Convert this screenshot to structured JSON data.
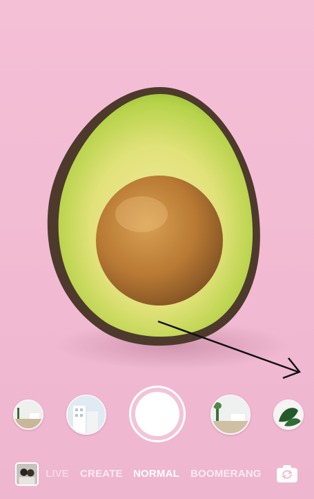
{
  "camera": {
    "background": "avocado-on-pink",
    "accent": "#ffffff",
    "backdrop_color": "#f2bcd4"
  },
  "filters": [
    {
      "name": "room-plant-filter"
    },
    {
      "name": "building-filter"
    },
    {
      "name": "interior-plant-filter"
    },
    {
      "name": "monstera-leaf-filter"
    }
  ],
  "modes": {
    "items": [
      "LIVE",
      "CREATE",
      "NORMAL",
      "BOOMERANG"
    ],
    "selected": "NORMAL"
  },
  "icons": {
    "gallery": "gallery-thumbnail-icon",
    "flip": "flip-camera-icon",
    "arrow": "swipe-arrow-icon"
  }
}
